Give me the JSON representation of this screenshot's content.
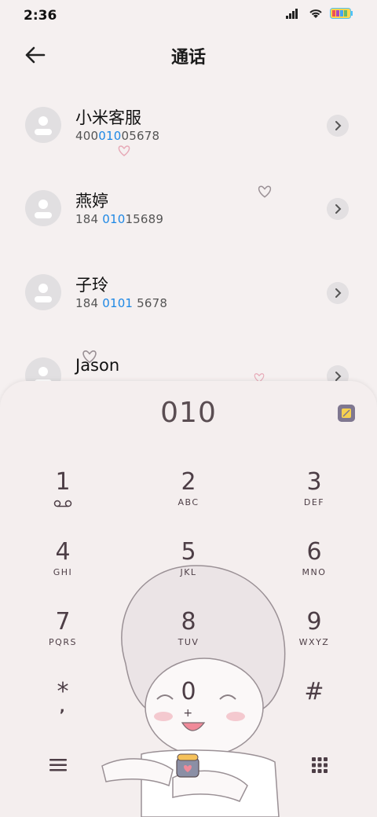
{
  "status": {
    "time": "2:36"
  },
  "header": {
    "title": "通话"
  },
  "contacts": [
    {
      "name": "小米客服",
      "num_pre": "400",
      "num_hl": "010",
      "num_post": "05678"
    },
    {
      "name": "燕婷",
      "num_pre": "184 ",
      "num_hl": "010",
      "num_post": "15689"
    },
    {
      "name": "子玲",
      "num_pre": "184 ",
      "num_hl": "0101",
      "num_post": " 5678"
    },
    {
      "name": "Jason",
      "num_pre": "",
      "num_hl": "",
      "num_post": ""
    }
  ],
  "dialer": {
    "input": "010",
    "keys": [
      {
        "digit": "1",
        "letters": ""
      },
      {
        "digit": "2",
        "letters": "ABC"
      },
      {
        "digit": "3",
        "letters": "DEF"
      },
      {
        "digit": "4",
        "letters": "GHI"
      },
      {
        "digit": "5",
        "letters": "JKL"
      },
      {
        "digit": "6",
        "letters": "MNO"
      },
      {
        "digit": "7",
        "letters": "PQRS"
      },
      {
        "digit": "8",
        "letters": "TUV"
      },
      {
        "digit": "9",
        "letters": "WXYZ"
      },
      {
        "digit": "*",
        "letters": ","
      },
      {
        "digit": "0",
        "letters": "+"
      },
      {
        "digit": "#",
        "letters": ""
      }
    ]
  },
  "colors": {
    "accent": "#1e88e5",
    "keypad_text": "#4d3e46",
    "background": "#f5f0f0"
  }
}
